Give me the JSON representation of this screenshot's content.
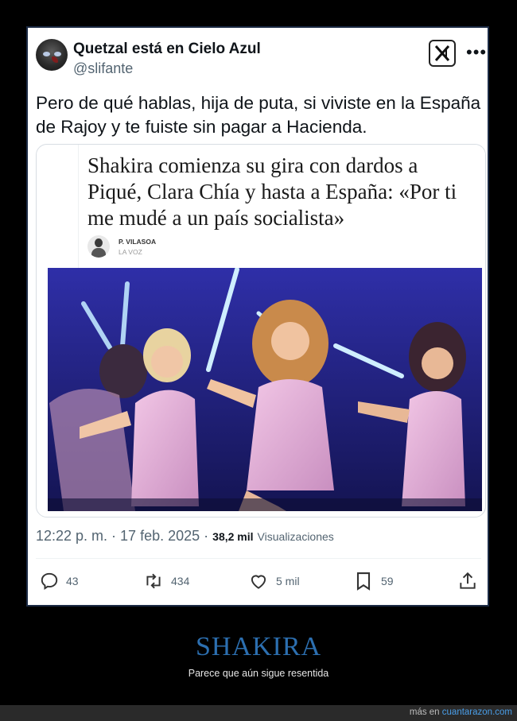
{
  "tweet": {
    "display_name": "Quetzal está en Cielo Azul",
    "handle": "@slifante",
    "text": "Pero de qué hablas, hija de puta, si viviste en la España de Rajoy y te fuiste sin pagar a Hacienda.",
    "more_icon": "more-horizontal-icon",
    "logo_icon": "x-logo-icon",
    "quote": {
      "headline": "Shakira comienza su gira con dardos a Piqué, Clara Chía y hasta a España: «Por ti me mudé a un país socialista»",
      "author": "P. VILASOA",
      "source": "LA VOZ"
    },
    "time": "12:22 p. m. · 17 feb. 2025 ·",
    "views_count": "38,2 mil",
    "views_label": "Visualizaciones",
    "actions": {
      "replies": "43",
      "retweets": "434",
      "likes": "5 mil",
      "bookmarks": "59"
    }
  },
  "footer": {
    "title": "SHAKIRA",
    "subtitle": "Parece que aún sigue resentida",
    "credit_prefix": "más en",
    "credit_link": "cuantarazon.com"
  },
  "colors": {
    "title_blue": "#2c6fb0",
    "link_blue": "#4a9ee8",
    "text_dark": "#0f1419",
    "text_gray": "#536471"
  }
}
